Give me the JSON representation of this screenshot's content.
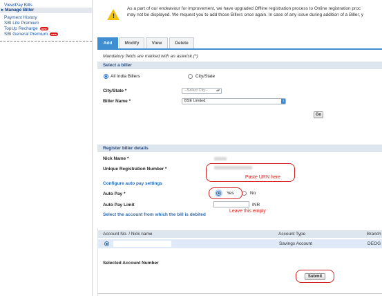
{
  "nav": {
    "items": [
      {
        "label": "View/Pay Bills"
      },
      {
        "label": "▸ Manage Biller"
      },
      {
        "label": "Payment History"
      },
      {
        "label": "SBI Life Premium"
      },
      {
        "label": "TopUp Recharge",
        "badge": "new"
      },
      {
        "label": "SBI General Premium",
        "badge": "new"
      }
    ]
  },
  "notice": {
    "text": "As a part of our endeavour for improvement, we have upgraded Offline registration process to Online registration proc\nmay not be displayed. We request you to add those Billers once again. In case of any issue during addition of a Biller, y",
    "icon": "warning-icon"
  },
  "tabs": [
    {
      "label": "Add"
    },
    {
      "label": "Modify"
    },
    {
      "label": "View"
    },
    {
      "label": "Delete"
    }
  ],
  "form": {
    "mandatory_note": "Mandatory fields are marked with an asterisk (*)",
    "select_biller": {
      "title": "Select a biller",
      "option_all_india": "All India Billers",
      "option_city_state": "City/State",
      "selected_option": "All India Billers",
      "city_state_label": "City/State *",
      "city_state_value": "--Select City--",
      "biller_name_label": "Biller Name *",
      "biller_name_value": "BSE Limited",
      "go_label": "Go"
    },
    "register": {
      "title": "Register biller details",
      "nick_name_label": "Nick Name *",
      "urn_label": "Unique Registration Number *",
      "auto_pay_heading": "Configure auto pay settings",
      "auto_pay_label": "Auto Pay *",
      "auto_pay_yes": "Yes",
      "auto_pay_no": "No",
      "auto_pay_selected": "Yes",
      "auto_pay_limit_label": "Auto Pay Limit",
      "currency": "INR",
      "debit_account_heading": "Select the account from which the bill is debited"
    },
    "accounts_table": {
      "columns": [
        "Account No. / Nick name",
        "Account Type",
        "Branch"
      ],
      "rows": [
        {
          "account": "",
          "type": "Savings Account",
          "branch": "DEOG"
        }
      ]
    },
    "selected_account_label": "Selected Account Number",
    "submit_label": "Submit"
  },
  "annotations": {
    "paste_urn": "Paste URN here",
    "leave_empty": "Leave this empty",
    "color": "#d21e1e"
  },
  "colors": {
    "accent": "#3f8ed1",
    "section_bar": "#dde5ef",
    "link": "#1a56a8"
  }
}
